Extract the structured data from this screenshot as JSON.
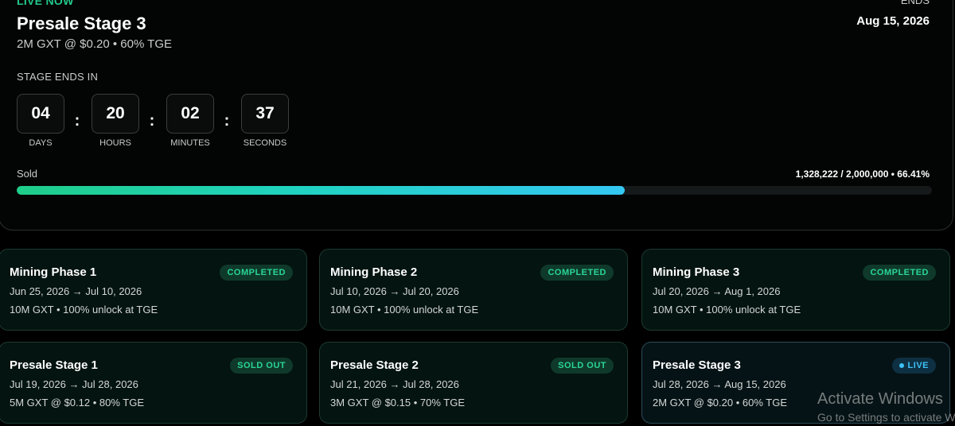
{
  "hero": {
    "status": "LIVE NOW",
    "title": "Presale Stage 3",
    "subtitle": "2M GXT @ $0.20 • 60% TGE",
    "ends_label": "ENDS",
    "ends_date": "Aug 15, 2026",
    "stage_ends_label": "STAGE ENDS IN",
    "countdown": {
      "days": "04",
      "days_label": "DAYS",
      "hours": "20",
      "hours_label": "HOURS",
      "minutes": "02",
      "minutes_label": "MINUTES",
      "seconds": "37",
      "seconds_label": "SECONDS",
      "separator": ":"
    },
    "sold_label": "Sold",
    "sold_stats": "1,328,222 / 2,000,000 • 66.41%",
    "sold_fraction": 0.6641,
    "colors": {
      "accent_green": "#22c98a",
      "accent_blue": "#34c8f2"
    }
  },
  "stages": [
    {
      "title": "Mining Phase 1",
      "dates": "Jun 25, 2026 → Jul 10, 2026",
      "info": "10M GXT • 100% unlock at TGE",
      "badge": "COMPLETED"
    },
    {
      "title": "Mining Phase 2",
      "dates": "Jul 10, 2026 → Jul 20, 2026",
      "info": "10M GXT • 100% unlock at TGE",
      "badge": "COMPLETED"
    },
    {
      "title": "Mining Phase 3",
      "dates": "Jul 20, 2026 → Aug 1, 2026",
      "info": "10M GXT • 100% unlock at TGE",
      "badge": "COMPLETED"
    },
    {
      "title": "Presale Stage 1",
      "dates": "Jul 19, 2026 → Jul 28, 2026",
      "info": "5M GXT @ $0.12 • 80% TGE",
      "badge": "SOLD OUT"
    },
    {
      "title": "Presale Stage 2",
      "dates": "Jul 21, 2026 → Jul 28, 2026",
      "info": "3M GXT @ $0.15 • 70% TGE",
      "badge": "SOLD OUT"
    },
    {
      "title": "Presale Stage 3",
      "dates": "Jul 28, 2026 → Aug 15, 2026",
      "info": "2M GXT @ $0.20 • 60% TGE",
      "badge": "LIVE"
    }
  ],
  "watermark": {
    "title": "Activate Windows",
    "subtitle": "Go to Settings to activate Windows."
  }
}
